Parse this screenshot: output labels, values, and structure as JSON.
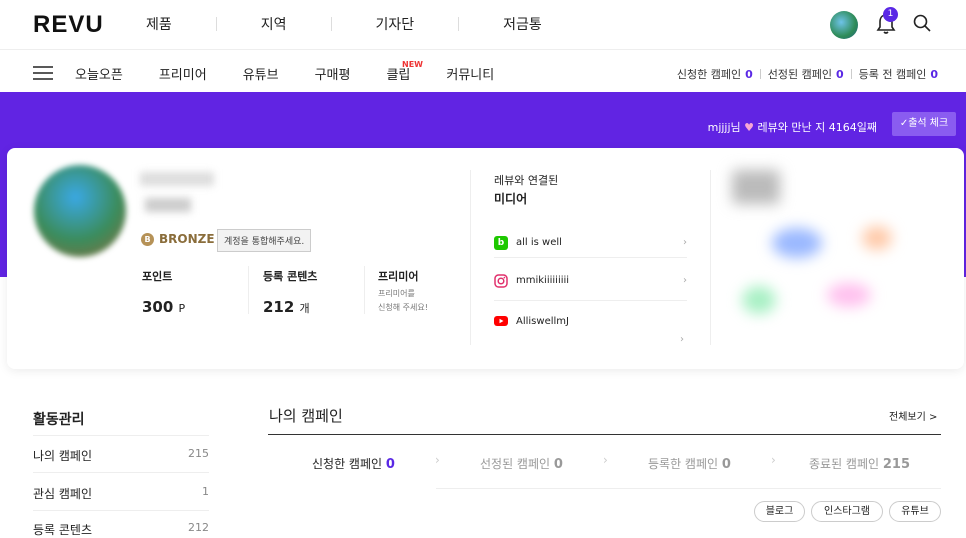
{
  "header": {
    "logo": "REVU",
    "nav": [
      "제품",
      "지역",
      "기자단",
      "저금통"
    ],
    "notification_count": "1"
  },
  "subnav": {
    "items": [
      "오늘오픈",
      "프리미어",
      "유튜브",
      "구매평",
      "클립",
      "커뮤니티"
    ],
    "new_tag": "NEW",
    "counts": [
      {
        "label": "신청한 캠페인",
        "value": "0"
      },
      {
        "label": "선정된 캠페인",
        "value": "0"
      },
      {
        "label": "등록 전 캠페인",
        "value": "0"
      }
    ]
  },
  "banner": {
    "greeting_user": "mjjjj님",
    "greeting_text": "레뷰와 만난 지 4164일째",
    "check_button": "출석 체크"
  },
  "profile": {
    "grade": "BRONZE",
    "merge_notice": "계정을 통합해주세요.",
    "stats": [
      {
        "label": "포인트",
        "value": "300",
        "unit": "P"
      },
      {
        "label": "등록 콘텐츠",
        "value": "212",
        "unit": "개"
      },
      {
        "label": "프리미어",
        "note1": "프리미어를",
        "note2": "신청해 주세요!"
      }
    ]
  },
  "media": {
    "title_line1": "레뷰와 연결된",
    "title_line2": "미디어",
    "items": [
      {
        "icon": "blog-icon",
        "name": "all is well"
      },
      {
        "icon": "instagram-icon",
        "name": "mmikiiiiiiiii"
      },
      {
        "icon": "youtube-icon",
        "name": "AlliswellmJ"
      }
    ]
  },
  "sidebar": {
    "title": "활동관리",
    "items": [
      {
        "label": "나의 캠페인",
        "count": "215"
      },
      {
        "label": "관심 캠페인",
        "count": "1"
      },
      {
        "label": "등록 콘텐츠",
        "count": "212"
      }
    ]
  },
  "my_campaign": {
    "title": "나의 캠페인",
    "view_all": "전체보기 >",
    "tabs": [
      {
        "label": "신청한 캠페인",
        "value": "0"
      },
      {
        "label": "선정된 캠페인",
        "value": "0"
      },
      {
        "label": "등록한 캠페인",
        "value": "0"
      },
      {
        "label": "종료된 캠페인",
        "value": "215"
      }
    ],
    "filters": [
      "블로그",
      "인스타그램",
      "유튜브"
    ]
  },
  "colors": {
    "accent": "#5a28e5",
    "banner": "#6124e3"
  }
}
